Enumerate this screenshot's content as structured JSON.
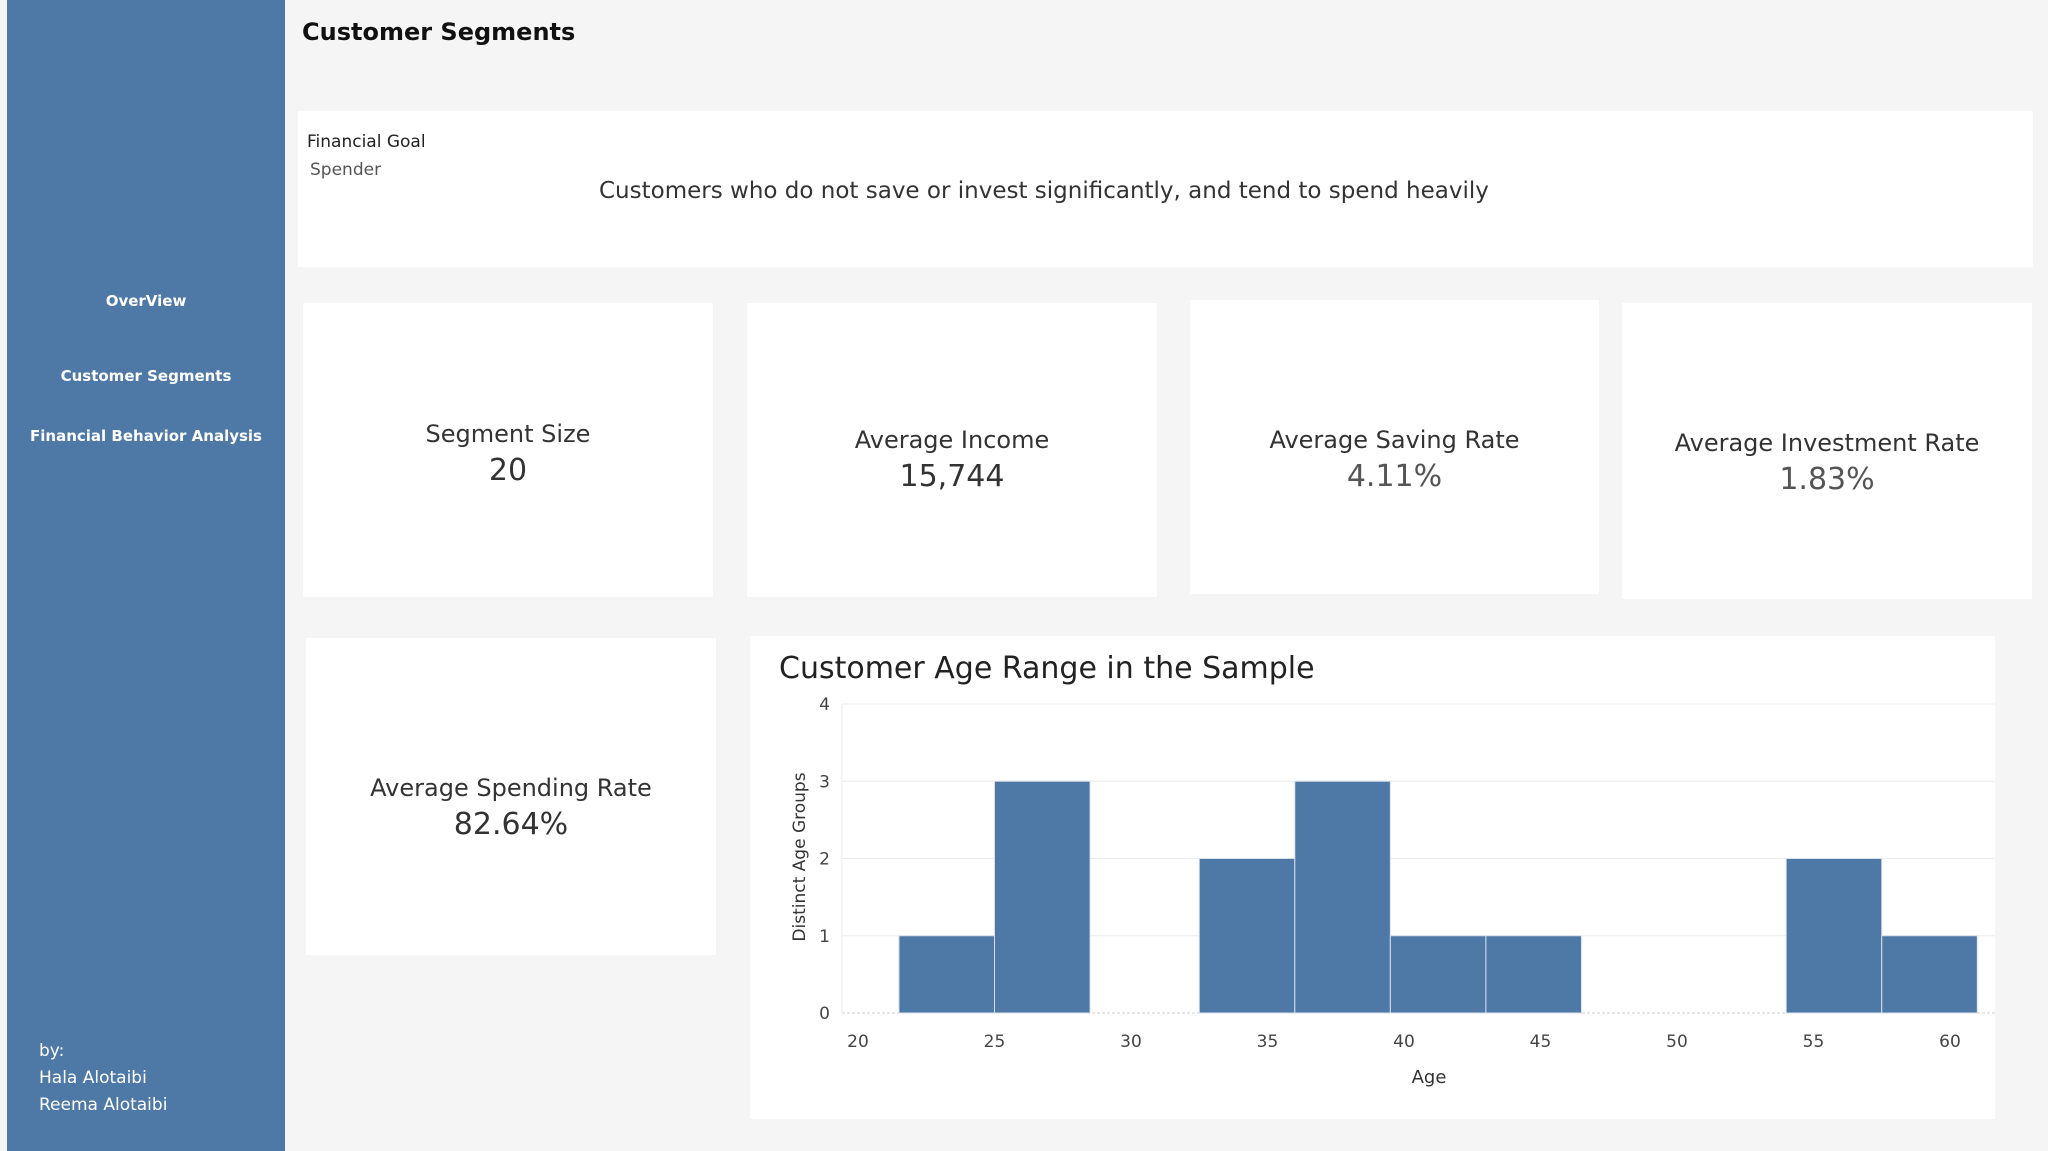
{
  "page": {
    "title": "Customer Segments"
  },
  "sidebar": {
    "items": [
      {
        "label": "OverView"
      },
      {
        "label": "Customer Segments"
      },
      {
        "label": "Financial Behavior Analysis"
      }
    ],
    "authors_label": "by:",
    "authors": [
      "Hala Alotaibi",
      "Reema Alotaibi"
    ]
  },
  "filter": {
    "label": "Financial Goal",
    "value": "Spender",
    "description": "Customers who do not save or invest significantly, and tend to spend heavily"
  },
  "kpis": {
    "segment_size": {
      "label": "Segment Size",
      "value": "20"
    },
    "avg_income": {
      "label": "Average Income",
      "value": "15,744"
    },
    "avg_saving": {
      "label": "Average Saving Rate",
      "value": "4.11%"
    },
    "avg_investment": {
      "label": "Average Investment Rate",
      "value": "1.83%"
    },
    "avg_spending": {
      "label": "Average Spending Rate",
      "value": "82.64%"
    }
  },
  "colors": {
    "sidebar": "#4e79a7",
    "bar": "#4e79a7"
  },
  "chart_data": {
    "type": "bar",
    "title": "Customer Age Range in the Sample",
    "xlabel": "Age",
    "ylabel": "Distinct Age Groups",
    "xlim": [
      19.5,
      62.5
    ],
    "ylim": [
      0,
      4
    ],
    "xticks": [
      20,
      25,
      30,
      35,
      40,
      45,
      50,
      55,
      60
    ],
    "yticks": [
      0,
      1,
      2,
      3,
      4
    ],
    "bins": [
      {
        "start": 21.5,
        "end": 25,
        "value": 1
      },
      {
        "start": 25,
        "end": 28.5,
        "value": 3
      },
      {
        "start": 32.5,
        "end": 36,
        "value": 2
      },
      {
        "start": 36,
        "end": 39.5,
        "value": 3
      },
      {
        "start": 39.5,
        "end": 43,
        "value": 1
      },
      {
        "start": 43,
        "end": 46.5,
        "value": 1
      },
      {
        "start": 54,
        "end": 57.5,
        "value": 2
      },
      {
        "start": 57.5,
        "end": 61,
        "value": 1
      }
    ]
  }
}
